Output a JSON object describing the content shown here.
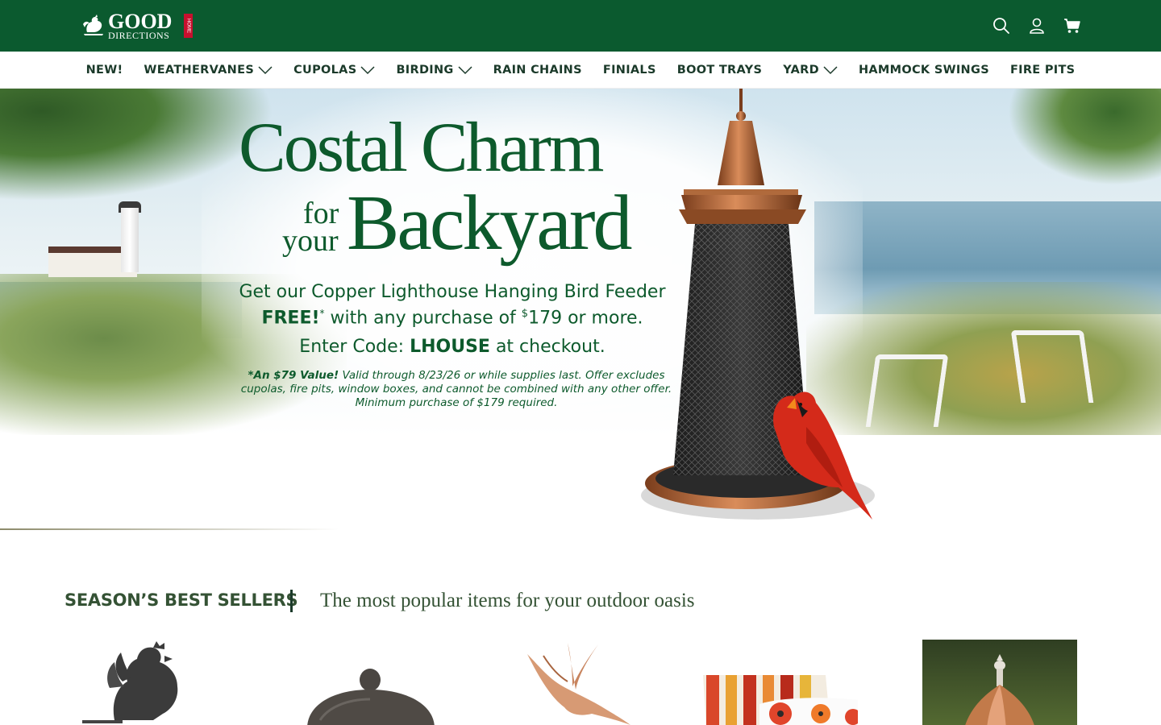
{
  "header": {
    "logo_good": "GOOD",
    "logo_directions": "DIRECTIONS",
    "logo_home": "HOME",
    "brand_color": "#0b5a2f",
    "icons": [
      "search-icon",
      "account-icon",
      "cart-icon"
    ]
  },
  "nav": {
    "items": [
      {
        "label": "NEW!",
        "dropdown": false
      },
      {
        "label": "WEATHERVANES",
        "dropdown": true
      },
      {
        "label": "CUPOLAS",
        "dropdown": true
      },
      {
        "label": "BIRDING",
        "dropdown": true
      },
      {
        "label": "RAIN CHAINS",
        "dropdown": false
      },
      {
        "label": "FINIALS",
        "dropdown": false
      },
      {
        "label": "BOOT TRAYS",
        "dropdown": false
      },
      {
        "label": "YARD",
        "dropdown": true
      },
      {
        "label": "HAMMOCK SWINGS",
        "dropdown": false
      },
      {
        "label": "FIRE PITS",
        "dropdown": false
      }
    ]
  },
  "hero": {
    "title": "Costal Charm",
    "for": "for",
    "your": "your",
    "backyard": "Backyard",
    "line1": "Get our Copper Lighthouse Hanging Bird Feeder",
    "line2_bold": "FREE!",
    "line2_sup": "*",
    "line2_a": " with any purchase of ",
    "line2_dollar": "$",
    "line2_b": "179 or more.",
    "line3_a": "Enter Code: ",
    "line3_code": "LHOUSE",
    "line3_b": " at checkout.",
    "fine_bold": "*An $79 Value!",
    "fine_text": " Valid through 8/23/26 or while supplies last. Offer excludes cupolas, fire pits, window boxes, and cannot be combined with any other offer. Minimum purchase of $179 required.",
    "accent_color": "#0d5a2c"
  },
  "best_sellers": {
    "title": "SEASON’S BEST SELLERS",
    "subtitle": "The most popular items for your outdoor oasis",
    "products": [
      {
        "icon": "rooster-weathervane-icon"
      },
      {
        "icon": "domed-lid-icon"
      },
      {
        "icon": "copper-bird-icon"
      },
      {
        "icon": "pillows-icon"
      },
      {
        "icon": "copper-cupola-icon"
      }
    ]
  }
}
